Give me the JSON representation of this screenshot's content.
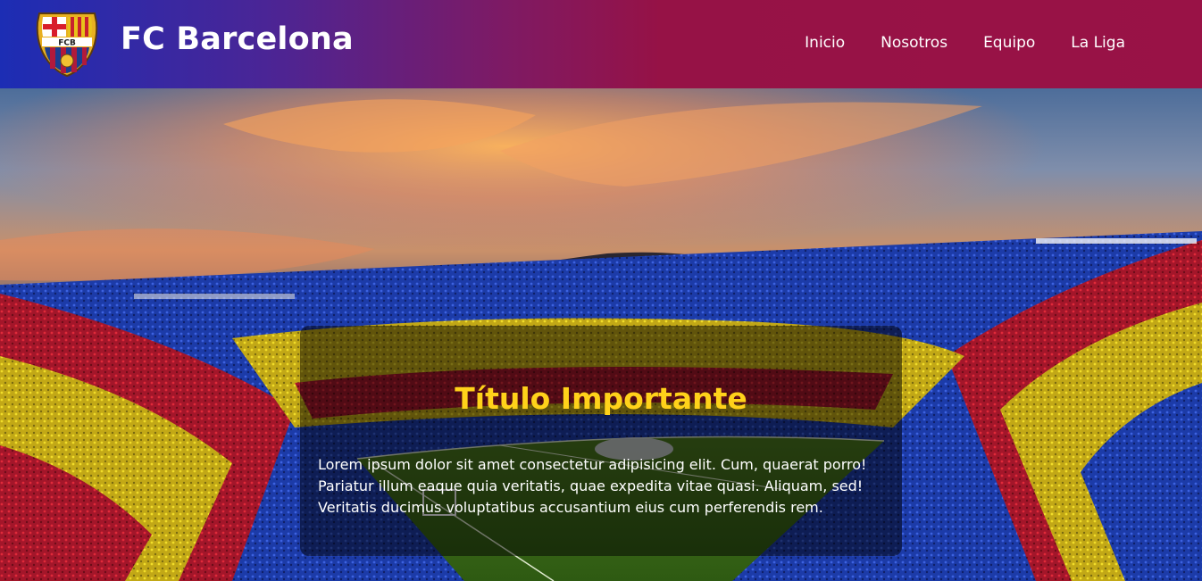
{
  "header": {
    "brand": "FC Barcelona",
    "logo_icon": "fcb-crest-icon",
    "logo_text": "FCB",
    "nav": [
      "Inicio",
      "Nosotros",
      "Equipo",
      "La Liga"
    ]
  },
  "hero": {
    "background": "stadium-at-sunset-image",
    "title": "Título Importante",
    "text": "Lorem ipsum dolor sit amet consectetur adipisicing elit. Cum, quaerat porro! Pariatur illum eaque quia veritatis, quae expedita vitae quasi. Aliquam, sed! Veritatis ducimus voluptatibus accusantium eius cum perferendis rem."
  },
  "colors": {
    "header_start": "#1c2db4",
    "header_end": "#991246",
    "title": "#ffd21a"
  }
}
